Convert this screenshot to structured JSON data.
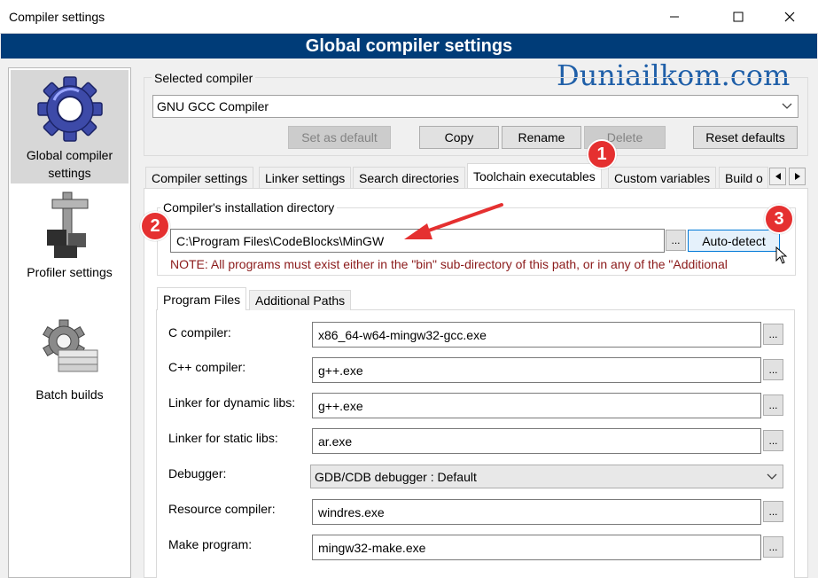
{
  "window": {
    "title": "Compiler settings",
    "banner": "Global compiler settings",
    "watermark": "Duniailkom.com"
  },
  "sidebar": {
    "items": [
      {
        "label": "Global compiler settings",
        "icon": "gear-icon",
        "selected": true
      },
      {
        "label": "Profiler settings",
        "icon": "caliper-icon"
      },
      {
        "label": "Batch builds",
        "icon": "batch-gear-icon"
      }
    ]
  },
  "compiler": {
    "group_label": "Selected compiler",
    "selected": "GNU GCC Compiler",
    "buttons": {
      "set_default": "Set as default",
      "copy": "Copy",
      "rename": "Rename",
      "delete": "Delete",
      "reset": "Reset defaults"
    }
  },
  "tabs": {
    "items": [
      "Compiler settings",
      "Linker settings",
      "Search directories",
      "Toolchain executables",
      "Custom variables",
      "Build o"
    ],
    "active": "Toolchain executables"
  },
  "install_dir": {
    "label": "Compiler's installation directory",
    "value": "C:\\Program Files\\CodeBlocks\\MinGW",
    "browse": "...",
    "auto_detect": "Auto-detect",
    "note": "NOTE: All programs must exist either in the \"bin\" sub-directory of this path, or in any of the \"Additional"
  },
  "inner_tabs": {
    "items": [
      "Program Files",
      "Additional Paths"
    ],
    "active": "Program Files"
  },
  "programs": [
    {
      "label": "C compiler:",
      "value": "x86_64-w64-mingw32-gcc.exe",
      "type": "text"
    },
    {
      "label": "C++ compiler:",
      "value": "g++.exe",
      "type": "text"
    },
    {
      "label": "Linker for dynamic libs:",
      "value": "g++.exe",
      "type": "text"
    },
    {
      "label": "Linker for static libs:",
      "value": "ar.exe",
      "type": "text"
    },
    {
      "label": "Debugger:",
      "value": "GDB/CDB debugger : Default",
      "type": "select"
    },
    {
      "label": "Resource compiler:",
      "value": "windres.exe",
      "type": "text"
    },
    {
      "label": "Make program:",
      "value": "mingw32-make.exe",
      "type": "text"
    }
  ],
  "annotations": {
    "badges": [
      "1",
      "2",
      "3"
    ],
    "color": "#e53030"
  },
  "colors": {
    "banner_bg": "#003c78",
    "note_text": "#8b1a1a",
    "brand_blue": "#1f5fa8"
  }
}
